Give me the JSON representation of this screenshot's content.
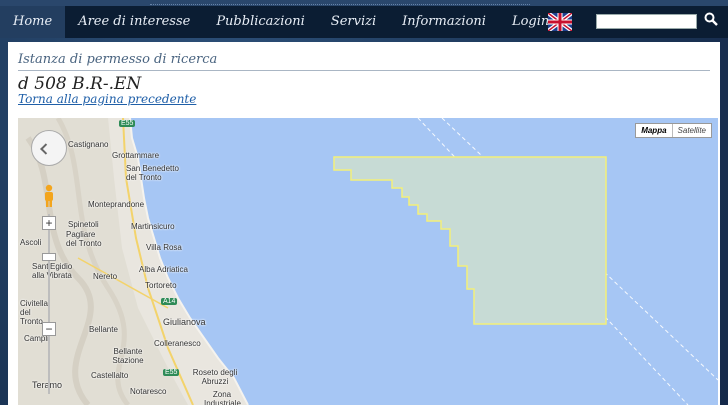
{
  "nav": {
    "items": [
      "Home",
      "Aree di interesse",
      "Pubblicazioni",
      "Servizi",
      "Informazioni",
      "Login"
    ],
    "active": "Home",
    "language_flag": "uk-flag-icon",
    "search_icon": "search-icon"
  },
  "page": {
    "subheading": "Istanza di permesso di ricerca",
    "title": "d 508 B.R-.EN",
    "back_link": "Torna alla pagina precedente"
  },
  "map": {
    "type_buttons": [
      "Mappa",
      "Satellite"
    ],
    "selected_type": "Mappa",
    "zoom_in": "+",
    "zoom_out": "−",
    "roads": [
      "E55",
      "A14",
      "E55"
    ],
    "places": [
      "Grottammare",
      "San Benedetto del Tronto",
      "Monteprandone",
      "Martinsicuro",
      "Spinetoli",
      "Pagliare del Tronto",
      "Villa Rosa",
      "Alba Adriatica",
      "Sant'Egidio alla Vibrata",
      "Nereto",
      "Tortoreto",
      "Civitella del Tronto",
      "Giulianova",
      "Bellante",
      "Colleranesco",
      "Bellante Stazione",
      "Castellalto",
      "Roseto degli Abruzzi",
      "Teramo",
      "Notaresco",
      "Zona Industriale",
      "Castignano",
      "Campli",
      "Ascoli"
    ],
    "colors": {
      "sea": "#a6c6f4",
      "land": "#e9e6df",
      "concession_fill": "#c7dbd5",
      "concession_border": "#f4f07a"
    }
  }
}
